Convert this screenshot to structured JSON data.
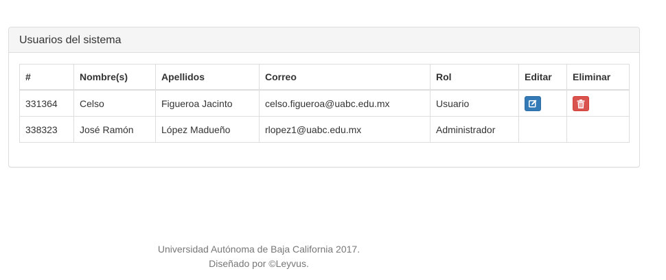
{
  "panel": {
    "title": "Usuarios del sistema"
  },
  "table": {
    "headers": [
      "#",
      "Nombre(s)",
      "Apellidos",
      "Correo",
      "Rol",
      "Editar",
      "Eliminar"
    ],
    "rows": [
      {
        "id": "331364",
        "nombre": "Celso",
        "apellidos": "Figueroa Jacinto",
        "correo": "celso.figueroa@uabc.edu.mx",
        "rol": "Usuario",
        "edit_icon": "edit-icon",
        "delete_icon": "trash-icon"
      },
      {
        "id": "338323",
        "nombre": "José Ramón",
        "apellidos": "López Madueño",
        "correo": "rlopez1@uabc.edu.mx",
        "rol": "Administrador"
      }
    ]
  },
  "footer": {
    "line1": "Universidad Autónoma de Baja California 2017.",
    "line2": "Diseñado por ©Leyvus."
  },
  "colors": {
    "edit_button": "#337ab7",
    "delete_button": "#d9534f",
    "panel_heading_bg": "#f5f5f5"
  }
}
